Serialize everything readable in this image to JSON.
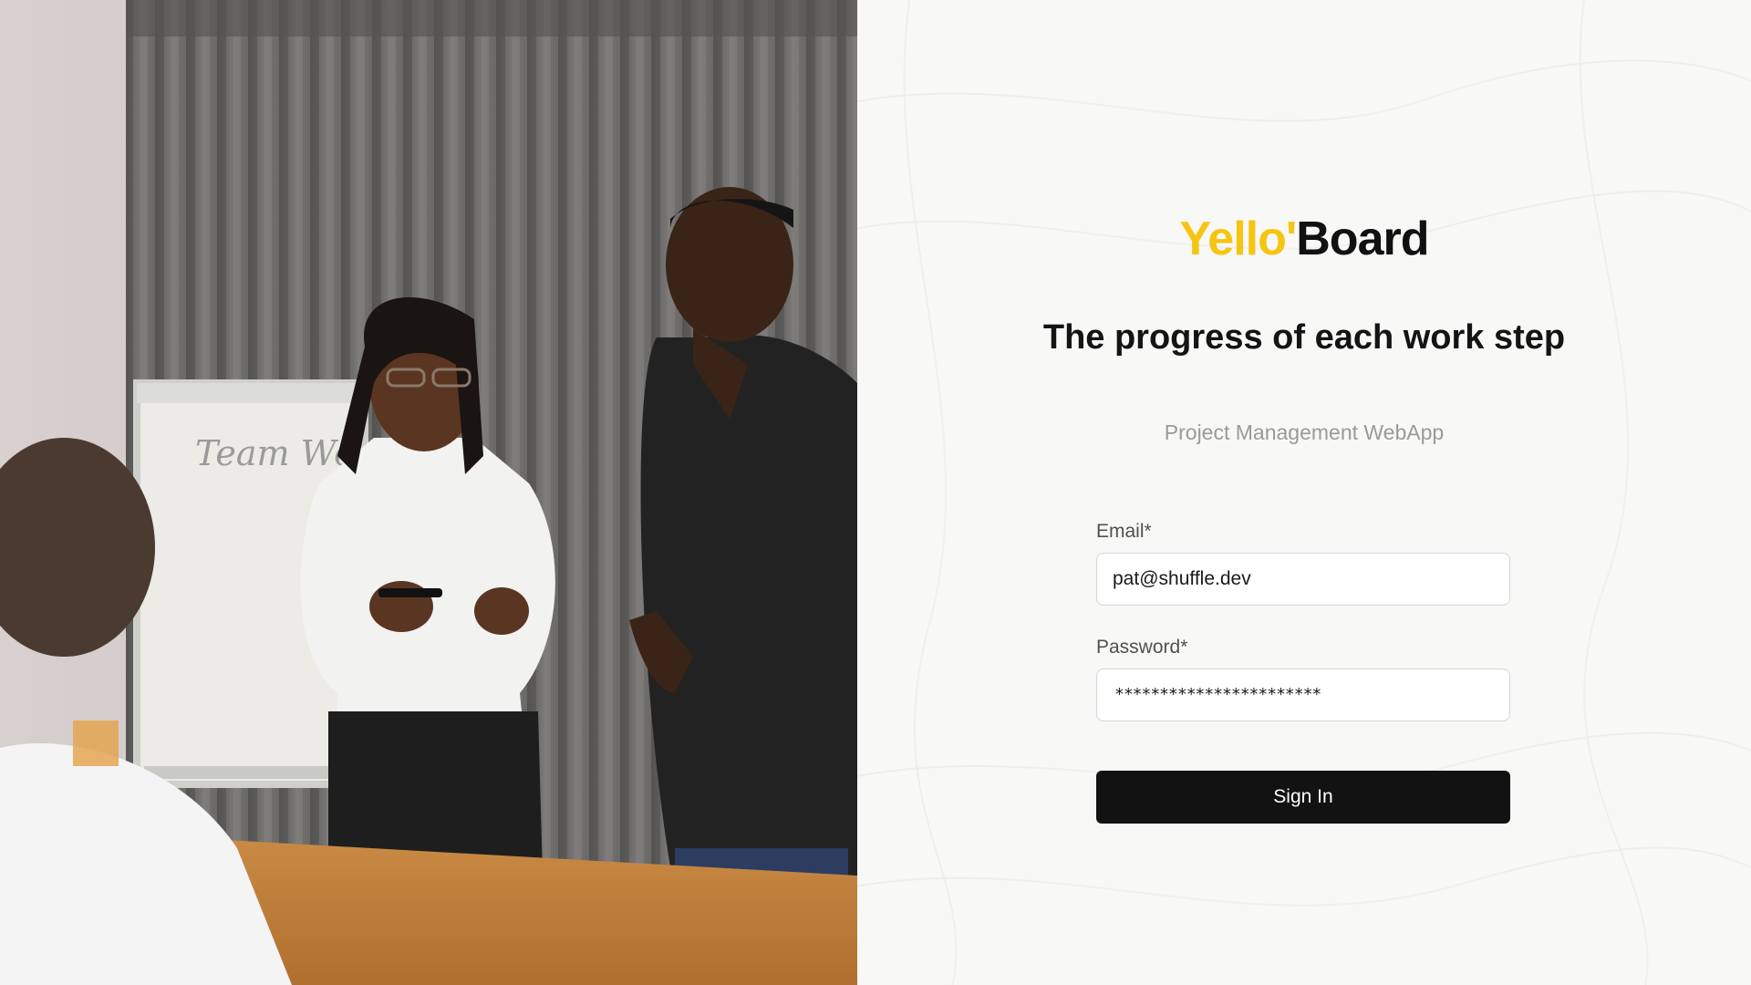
{
  "photo": {
    "flipchart_text": "Team Wo",
    "alt_description": ""
  },
  "brand": {
    "part1": "Yello'",
    "part2": "Board",
    "accent_color": "#f6c512",
    "dark_color": "#111111"
  },
  "hero": {
    "headline": "The progress of each work step",
    "subtitle": "Project Management WebApp"
  },
  "form": {
    "email_label": "Email*",
    "email_value": "pat@shuffle.dev",
    "password_label": "Password*",
    "password_mask": "***********************",
    "submit_label": "Sign In"
  }
}
